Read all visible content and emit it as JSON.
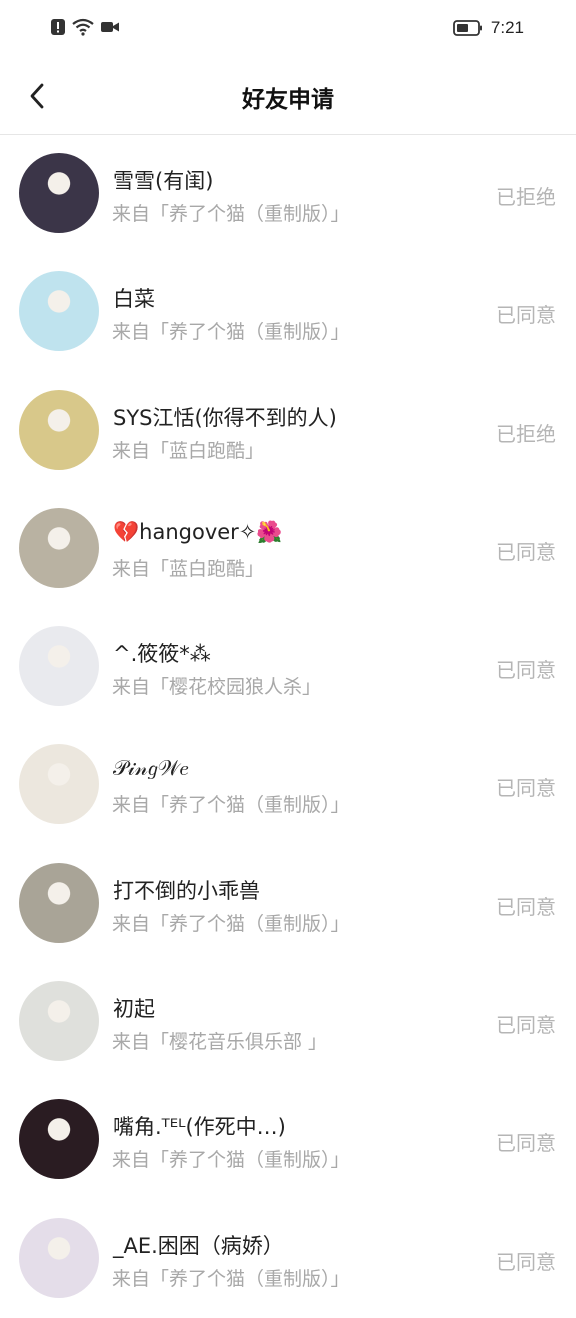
{
  "status_bar": {
    "time": "7:21"
  },
  "header": {
    "title": "好友申请"
  },
  "items": [
    {
      "name": "雪雪(有闺)",
      "source": "来自「养了个猫（重制版）」",
      "status": "已拒绝",
      "avatar_color": "#3b3548"
    },
    {
      "name": "白菜",
      "source": "来自「养了个猫（重制版）」",
      "status": "已同意",
      "avatar_color": "#bfe3ee"
    },
    {
      "name": "SYS江恬(你得不到的人)",
      "source": "来自「蓝白跑酷」",
      "status": "已拒绝",
      "avatar_color": "#d8c88a"
    },
    {
      "name": "💔hangover✧🌺",
      "source": "来自「蓝白跑酷」",
      "status": "已同意",
      "avatar_color": "#b9b2a2"
    },
    {
      "name": "^.筱筱*⁂",
      "source": "来自「樱花校园狼人杀」",
      "status": "已同意",
      "avatar_color": "#e9eaee"
    },
    {
      "name": "𝒫𝒾𝓃𝑔𝒲𝑒",
      "source": "来自「养了个猫（重制版）」",
      "status": "已同意",
      "avatar_color": "#ece7de"
    },
    {
      "name": "打不倒的小乖兽",
      "source": "来自「养了个猫（重制版）」",
      "status": "已同意",
      "avatar_color": "#a9a497"
    },
    {
      "name": "初起",
      "source": "来自「樱花音乐俱乐部 」",
      "status": "已同意",
      "avatar_color": "#dfe0dc"
    },
    {
      "name": "嘴角.ᵀᴱᴸ(作死中…)",
      "source": "来自「养了个猫（重制版）」",
      "status": "已同意",
      "avatar_color": "#2a1c22"
    },
    {
      "name": "_AE.困困（病娇）",
      "source": "来自「养了个猫（重制版）」",
      "status": "已同意",
      "avatar_color": "#e4dde9"
    }
  ]
}
